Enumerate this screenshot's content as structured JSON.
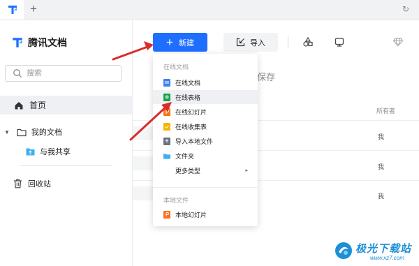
{
  "window": {
    "tab_add_icon": "plus-icon",
    "refresh_icon": "sync-icon"
  },
  "sidebar": {
    "brand": "腾讯文档",
    "search_placeholder": "搜索",
    "home": "首页",
    "my_docs": "我的文档",
    "shared_with_me": "与我共享",
    "recycle_bin": "回收站"
  },
  "toolbar": {
    "new_label": "新建",
    "import_label": "导入"
  },
  "content": {
    "save_text": "保存",
    "owner_header": "所有者",
    "rows": [
      {
        "owner": "我"
      },
      {
        "owner": "我"
      },
      {
        "owner": "我"
      }
    ]
  },
  "new_menu": {
    "online_section": "在线文档",
    "items": [
      {
        "label": "在线文档",
        "icon": "doc-icon",
        "color": "#3b82f6"
      },
      {
        "label": "在线表格",
        "icon": "sheet-icon",
        "color": "#16a34a"
      },
      {
        "label": "在线幻灯片",
        "icon": "slides-icon",
        "color": "#f97316"
      },
      {
        "label": "在线收集表",
        "icon": "form-icon",
        "color": "#f5b400"
      },
      {
        "label": "导入本地文件",
        "icon": "upload-icon",
        "color": "#6b7280"
      },
      {
        "label": "文件夹",
        "icon": "folder-icon",
        "color": "#3ab0f2"
      },
      {
        "label": "更多类型",
        "icon": "",
        "color": ""
      }
    ],
    "local_section": "本地文件",
    "local_items": [
      {
        "label": "本地幻灯片",
        "icon": "slides-icon",
        "color": "#f97316"
      }
    ]
  },
  "watermark": {
    "title": "极光下载站",
    "url": "www.xz7.com"
  },
  "colors": {
    "accent": "#1e6fff",
    "arrow": "#d92c2c"
  }
}
